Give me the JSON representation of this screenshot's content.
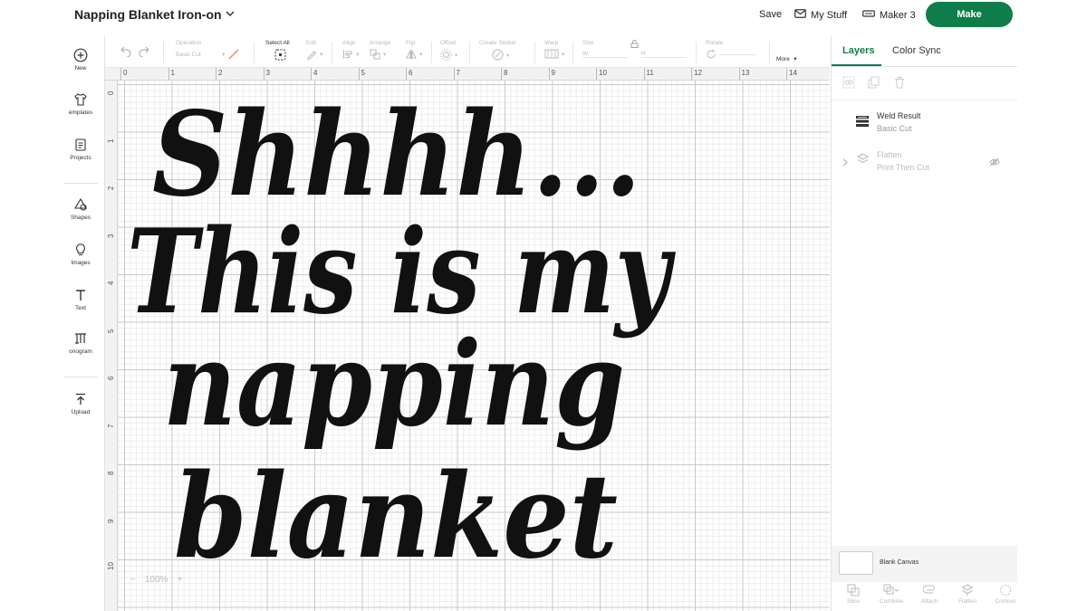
{
  "header": {
    "project_title": "Napping Blanket Iron-on",
    "save_label": "Save",
    "mystuff_label": "My Stuff",
    "machine_label": "Maker 3",
    "make_label": "Make"
  },
  "leftbar": {
    "items": [
      {
        "label": "New",
        "icon": "plus-circle-icon"
      },
      {
        "label": "emplates",
        "icon": "shirt-icon"
      },
      {
        "label": "Projects",
        "icon": "projects-icon"
      },
      {
        "label": "Shapes",
        "icon": "shapes-icon"
      },
      {
        "label": "Images",
        "icon": "lightbulb-icon"
      },
      {
        "label": "Text",
        "icon": "text-icon"
      },
      {
        "label": "onogram",
        "icon": "monogram-icon"
      },
      {
        "label": "Upload",
        "icon": "upload-icon"
      }
    ]
  },
  "toolbar": {
    "operation_label": "Operation",
    "operation_value": "Basic Cut",
    "select_all_label": "Select All",
    "edit_label": "Edit",
    "align_label": "Align",
    "arrange_label": "Arrange",
    "flip_label": "Flip",
    "offset_label": "Offset",
    "create_sticker_label": "Create Sticker",
    "warp_label": "Warp",
    "size_label": "Size",
    "size_w": "W",
    "size_h": "H",
    "rotate_label": "Rotate",
    "more_label": "More"
  },
  "ruler": {
    "top_ticks": [
      "0",
      "1",
      "2",
      "3",
      "4",
      "5",
      "6",
      "7",
      "8",
      "9",
      "10",
      "11",
      "12",
      "13",
      "14"
    ],
    "left_ticks": [
      "0",
      "1",
      "2",
      "3",
      "4",
      "5",
      "6",
      "7",
      "8",
      "9",
      "10"
    ]
  },
  "canvas": {
    "design_lines": [
      "Shhhh...",
      "This is my",
      "napping",
      "blanket"
    ],
    "zoom": "100%",
    "zoom_minus": "−",
    "zoom_plus": "+"
  },
  "rightpanel": {
    "tab_layers": "Layers",
    "tab_color_sync": "Color Sync",
    "layers": [
      {
        "name": "Weld Result",
        "sub": "Basic Cut"
      },
      {
        "name": "Flatten",
        "sub": "Print Then Cut"
      }
    ],
    "blank_canvas_label": "Blank Canvas",
    "bottom_tools": [
      "Slice",
      "Combine",
      "Attach",
      "Flatten",
      "Contour"
    ]
  },
  "colors": {
    "accent": "#0f7d4a",
    "grid_major": "#c9c9c9",
    "grid_minor": "#ececec",
    "design_fill": "#111111"
  }
}
